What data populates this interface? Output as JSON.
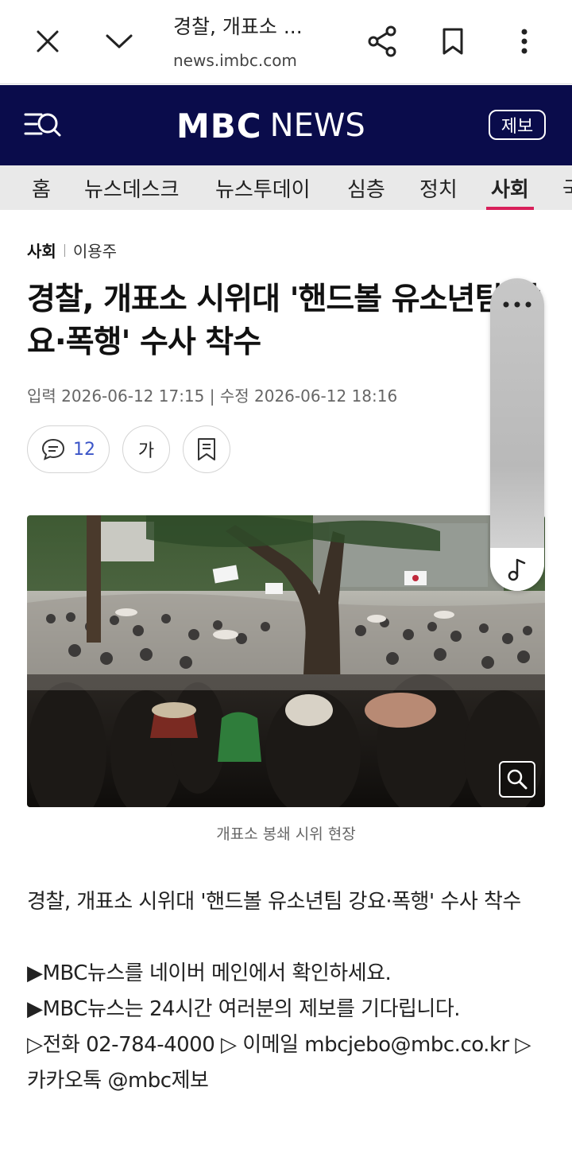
{
  "browser": {
    "title": "경찰, 개표소 ...",
    "url": "news.imbc.com"
  },
  "header": {
    "logo_mbc": "MBC",
    "logo_news": "NEWS",
    "report_label": "제보"
  },
  "nav": {
    "items": [
      {
        "label": "홈"
      },
      {
        "label": "뉴스데스크"
      },
      {
        "label": "뉴스투데이"
      },
      {
        "label": "심층"
      },
      {
        "label": "정치"
      },
      {
        "label": "사회",
        "active": true
      },
      {
        "label": "국"
      }
    ]
  },
  "article": {
    "section": "사회",
    "author": "이용주",
    "headline": "경찰, 개표소 시위대 '핸드볼 유소년팀 강요·폭행' 수사 착수",
    "dates": "입력 2026-06-12 17:15 | 수정 2026-06-12 18:16",
    "comment_count": "12",
    "font_size_label": "가",
    "photo_caption": "개표소 봉쇄 시위 현장",
    "body": [
      "경찰, 개표소 시위대 '핸드볼 유소년팀 강요·폭행' 수사 착수",
      "▶MBC뉴스를 네이버 메인에서 확인하세요.",
      "▶MBC뉴스는 24시간 여러분의 제보를 기다립니다.",
      "▷전화 02-784-4000 ▷ 이메일 mbcjebo@mbc.co.kr ▷ 카카오톡 @mbc제보"
    ]
  },
  "colors": {
    "header_bg": "#0a0c4b",
    "nav_bg": "#e9e9e9",
    "active_underline": "#d8205a",
    "comment_count": "#3b55c8"
  }
}
